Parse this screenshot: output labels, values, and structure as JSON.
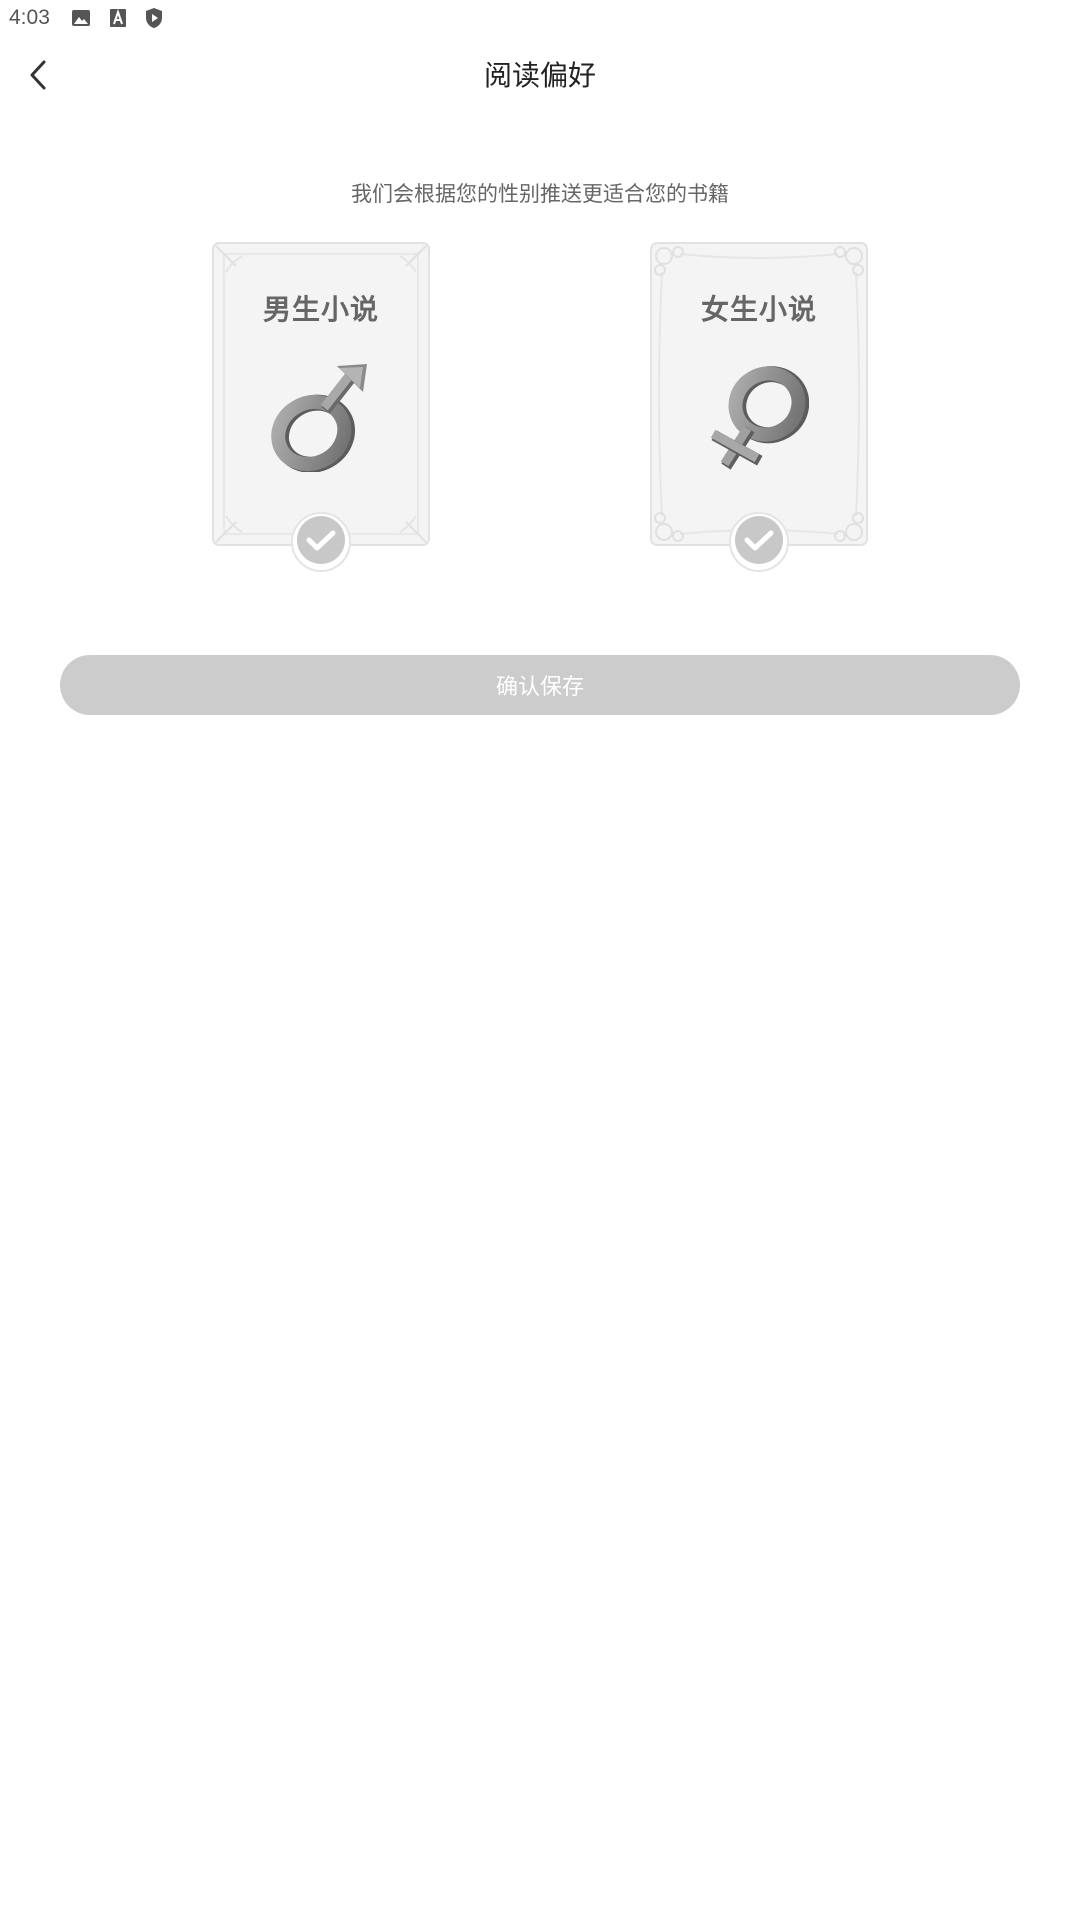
{
  "status_bar": {
    "time": "4:03",
    "icons": [
      "image-icon",
      "a-icon",
      "shield-play-icon"
    ]
  },
  "header": {
    "title": "阅读偏好",
    "back_icon": "chevron-left-icon"
  },
  "subtitle": "我们会根据您的性别推送更适合您的书籍",
  "options": [
    {
      "label": "男生小说",
      "icon": "male-symbol-icon",
      "selected": false
    },
    {
      "label": "女生小说",
      "icon": "female-symbol-icon",
      "selected": false
    }
  ],
  "confirm_label": "确认保存",
  "colors": {
    "button_disabled": "#cccccc",
    "title_text": "#222222",
    "subtitle_text": "#666666",
    "card_bg": "#f4f4f4"
  }
}
